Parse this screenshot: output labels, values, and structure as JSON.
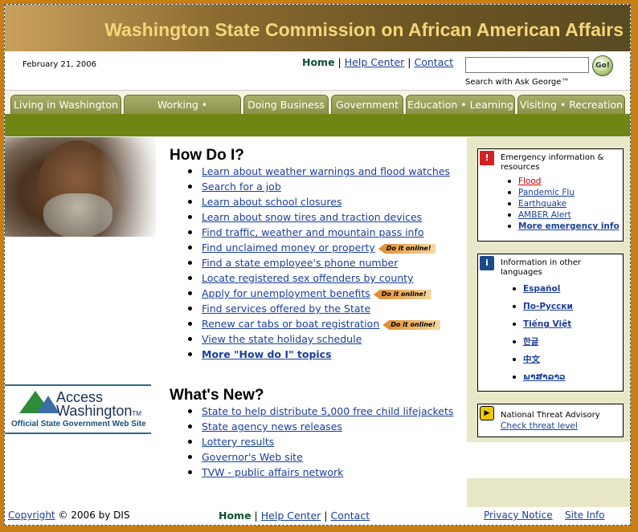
{
  "banner": {
    "title": "Washington State Commission on African American Affairs"
  },
  "topbar": {
    "date": "February 21, 2006",
    "home": "Home",
    "sep": "|",
    "help": "Help Center",
    "contact": "Contact",
    "search_value": "",
    "go_label": "Go!",
    "search_label": "Search with Ask George™"
  },
  "nav": {
    "tabs": [
      {
        "label": "Living in Washington"
      },
      {
        "label": "Working • Employment"
      },
      {
        "label": "Doing Business"
      },
      {
        "label": "Government"
      },
      {
        "label": "Education • Learning"
      },
      {
        "label": "Visiting • Recreation"
      }
    ]
  },
  "howdoi": {
    "title": "How Do I?",
    "badge": "Do it online!",
    "items": [
      {
        "label": "Learn about weather warnings and flood watches"
      },
      {
        "label": "Search for a job"
      },
      {
        "label": "Learn about school closures"
      },
      {
        "label": "Learn about snow tires and traction devices"
      },
      {
        "label": "Find traffic, weather and mountain pass info"
      },
      {
        "label": "Find unclaimed money or property"
      },
      {
        "label": "Find a state employee's phone number"
      },
      {
        "label": "Locate registered sex offenders by county"
      },
      {
        "label": "Apply for unemployment benefits"
      },
      {
        "label": "Find services offered by the State"
      },
      {
        "label": "Renew car tabs or boat registration"
      },
      {
        "label": "View the state holiday schedule"
      },
      {
        "label": "More \"How do I\" topics"
      }
    ]
  },
  "whatsnew": {
    "title": "What's New?",
    "items": [
      {
        "label": "State to help distribute 5,000 free child lifejackets"
      },
      {
        "label": "State agency news releases"
      },
      {
        "label": "Lottery results"
      },
      {
        "label": "Governor's Web site"
      },
      {
        "label": "TVW - public affairs network"
      }
    ]
  },
  "access": {
    "line1": "Access",
    "line2": "Washington",
    "tm": "TM",
    "tagline": "Official State Government Web Site"
  },
  "emergency": {
    "icon": "!",
    "title": "Emergency information & resources",
    "items": [
      {
        "label": "Flood"
      },
      {
        "label": "Pandemic Flu"
      },
      {
        "label": "Earthquake"
      },
      {
        "label": "AMBER Alert"
      },
      {
        "label": "More emergency info"
      }
    ],
    "alert_color": "#cc0000"
  },
  "languages": {
    "icon": "i",
    "title": "Information in other languages",
    "items": [
      {
        "label": "Español"
      },
      {
        "label": "По-Русски"
      },
      {
        "label": "Tiếng Việt"
      },
      {
        "label": "한글"
      },
      {
        "label": "中文"
      },
      {
        "label": "ພາສາລາວ"
      }
    ]
  },
  "threat": {
    "icon": "▶",
    "title": "National Threat Advisory",
    "link": "Check threat level"
  },
  "footer": {
    "copyright_link": "Copyright",
    "copyright_rest": "© 2006 by DIS",
    "home": "Home",
    "sep": "|",
    "help": "Help Center",
    "contact": "Contact",
    "privacy": "Privacy Notice",
    "siteinfo": "Site Info"
  }
}
